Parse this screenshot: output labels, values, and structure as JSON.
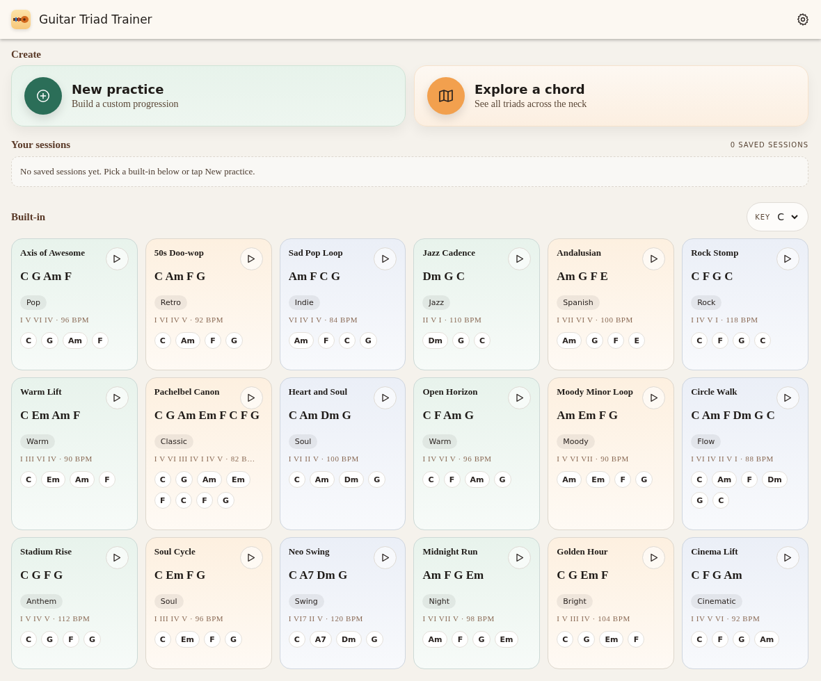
{
  "app": {
    "title": "Guitar Triad Trainer"
  },
  "create": {
    "heading": "Create",
    "actions": [
      {
        "kind": "practice",
        "title": "New practice",
        "subtitle": "Build a custom progression"
      },
      {
        "kind": "explore",
        "title": "Explore a chord",
        "subtitle": "See all triads across the neck"
      }
    ]
  },
  "sessions": {
    "heading": "Your sessions",
    "count": "0 SAVED SESSIONS",
    "empty": "No saved sessions yet. Pick a built-in below or tap New practice."
  },
  "builtin": {
    "heading": "Built-in",
    "key_label": "KEY",
    "key_value": "C",
    "progressions": [
      {
        "name": "Axis of Awesome",
        "chords": "C G Am F",
        "tag": "Pop",
        "meta": "I V VI IV · 96 BPM",
        "chips": [
          "C",
          "G",
          "Am",
          "F"
        ],
        "color": "#e8f3ec"
      },
      {
        "name": "50s Doo-wop",
        "chords": "C Am F G",
        "tag": "Retro",
        "meta": "I VI IV V · 92 BPM",
        "chips": [
          "C",
          "Am",
          "F",
          "G"
        ],
        "color": "#fdf0e0"
      },
      {
        "name": "Sad Pop Loop",
        "chords": "Am F C G",
        "tag": "Indie",
        "meta": "VI IV I V · 84 BPM",
        "chips": [
          "Am",
          "F",
          "C",
          "G"
        ],
        "color": "#ebeff7"
      },
      {
        "name": "Jazz Cadence",
        "chords": "Dm G C",
        "tag": "Jazz",
        "meta": "II V I · 110 BPM",
        "chips": [
          "Dm",
          "G",
          "C"
        ],
        "color": "#e8f3ec"
      },
      {
        "name": "Andalusian",
        "chords": "Am G F E",
        "tag": "Spanish",
        "meta": "I VII VI V · 100 BPM",
        "chips": [
          "Am",
          "G",
          "F",
          "E"
        ],
        "color": "#fdf0e0"
      },
      {
        "name": "Rock Stomp",
        "chords": "C F G C",
        "tag": "Rock",
        "meta": "I IV V I · 118 BPM",
        "chips": [
          "C",
          "F",
          "G",
          "C"
        ],
        "color": "#ebeff7"
      },
      {
        "name": "Warm Lift",
        "chords": "C Em Am F",
        "tag": "Warm",
        "meta": "I III VI IV · 90 BPM",
        "chips": [
          "C",
          "Em",
          "Am",
          "F"
        ],
        "color": "#e8f3ec"
      },
      {
        "name": "Pachelbel Canon",
        "chords": "C G Am Em F C F G",
        "tag": "Classic",
        "meta": "I V VI III IV I IV V · 82 B…",
        "chips": [
          "C",
          "G",
          "Am",
          "Em",
          "F",
          "C",
          "F",
          "G"
        ],
        "color": "#fdf0e0"
      },
      {
        "name": "Heart and Soul",
        "chords": "C Am Dm G",
        "tag": "Soul",
        "meta": "I VI II V · 100 BPM",
        "chips": [
          "C",
          "Am",
          "Dm",
          "G"
        ],
        "color": "#ebeff7"
      },
      {
        "name": "Open Horizon",
        "chords": "C F Am G",
        "tag": "Warm",
        "meta": "I IV VI V · 96 BPM",
        "chips": [
          "C",
          "F",
          "Am",
          "G"
        ],
        "color": "#e8f3ec"
      },
      {
        "name": "Moody Minor Loop",
        "chords": "Am Em F G",
        "tag": "Moody",
        "meta": "I V VI VII · 90 BPM",
        "chips": [
          "Am",
          "Em",
          "F",
          "G"
        ],
        "color": "#fdf0e0"
      },
      {
        "name": "Circle Walk",
        "chords": "C Am F Dm G C",
        "tag": "Flow",
        "meta": "I VI IV II V I · 88 BPM",
        "chips": [
          "C",
          "Am",
          "F",
          "Dm",
          "G",
          "C"
        ],
        "color": "#ebeff7"
      },
      {
        "name": "Stadium Rise",
        "chords": "C G F G",
        "tag": "Anthem",
        "meta": "I V IV V · 112 BPM",
        "chips": [
          "C",
          "G",
          "F",
          "G"
        ],
        "color": "#e8f3ec"
      },
      {
        "name": "Soul Cycle",
        "chords": "C Em F G",
        "tag": "Soul",
        "meta": "I III IV V · 96 BPM",
        "chips": [
          "C",
          "Em",
          "F",
          "G"
        ],
        "color": "#fdf0e0"
      },
      {
        "name": "Neo Swing",
        "chords": "C A7 Dm G",
        "tag": "Swing",
        "meta": "I VI7 II V · 120 BPM",
        "chips": [
          "C",
          "A7",
          "Dm",
          "G"
        ],
        "color": "#ebeff7"
      },
      {
        "name": "Midnight Run",
        "chords": "Am F G Em",
        "tag": "Night",
        "meta": "I VI VII V · 98 BPM",
        "chips": [
          "Am",
          "F",
          "G",
          "Em"
        ],
        "color": "#e8f3ec"
      },
      {
        "name": "Golden Hour",
        "chords": "C G Em F",
        "tag": "Bright",
        "meta": "I V III IV · 104 BPM",
        "chips": [
          "C",
          "G",
          "Em",
          "F"
        ],
        "color": "#fdf0e0"
      },
      {
        "name": "Cinema Lift",
        "chords": "C F G Am",
        "tag": "Cinematic",
        "meta": "I IV V VI · 92 BPM",
        "chips": [
          "C",
          "F",
          "G",
          "Am"
        ],
        "color": "#ebeff7"
      }
    ]
  }
}
